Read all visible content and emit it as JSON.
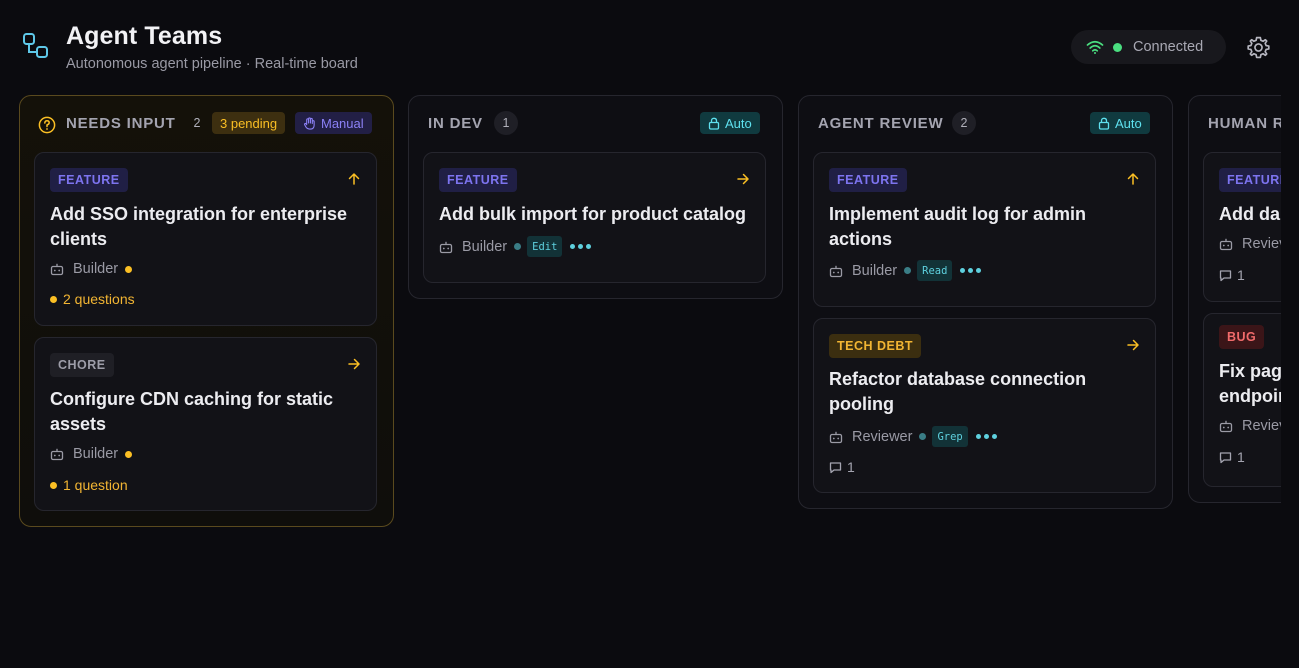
{
  "app": {
    "title": "Agent Teams",
    "subtitle": "Autonomous agent pipeline · Real-time board",
    "connection_status": "Connected",
    "colors": {
      "accent": "#7d74f0",
      "connected": "#4ade80",
      "warning": "#fbbf24",
      "auto": "#5ee0ee"
    }
  },
  "columns": [
    {
      "title": "NEEDS INPUT",
      "count": "2",
      "pending": "3 pending",
      "mode": "Manual",
      "cards": [
        {
          "tag": "FEATURE",
          "title": "Add SSO integration for enterprise clients",
          "agent": "Builder",
          "questions": "2 questions",
          "priority_icon": "arrow-up-icon"
        },
        {
          "tag": "CHORE",
          "title": "Configure CDN caching for static assets",
          "agent": "Builder",
          "questions": "1 question",
          "priority_icon": "arrow-right-icon"
        }
      ]
    },
    {
      "title": "IN DEV",
      "count": "1",
      "mode": "Auto",
      "cards": [
        {
          "tag": "FEATURE",
          "title": "Add bulk import for product catalog",
          "agent": "Builder",
          "tool": "Edit",
          "priority_icon": "arrow-right-icon"
        }
      ]
    },
    {
      "title": "AGENT REVIEW",
      "count": "2",
      "mode": "Auto",
      "cards": [
        {
          "tag": "FEATURE",
          "title": "Implement audit log for admin actions",
          "agent": "Builder",
          "tool": "Read",
          "priority_icon": "arrow-up-icon"
        },
        {
          "tag": "TECH DEBT",
          "title": "Refactor database connection pooling",
          "agent": "Reviewer",
          "tool": "Grep",
          "comments": "1",
          "priority_icon": "arrow-right-icon"
        }
      ]
    },
    {
      "title": "HUMAN R",
      "cards": [
        {
          "tag": "FEATURE",
          "title": "Add dar",
          "agent": "Reviev",
          "comments": "1"
        },
        {
          "tag": "BUG",
          "title_line1": "Fix pag",
          "title_line2": "endpoir",
          "agent": "Reviev",
          "comments": "1"
        }
      ]
    }
  ]
}
